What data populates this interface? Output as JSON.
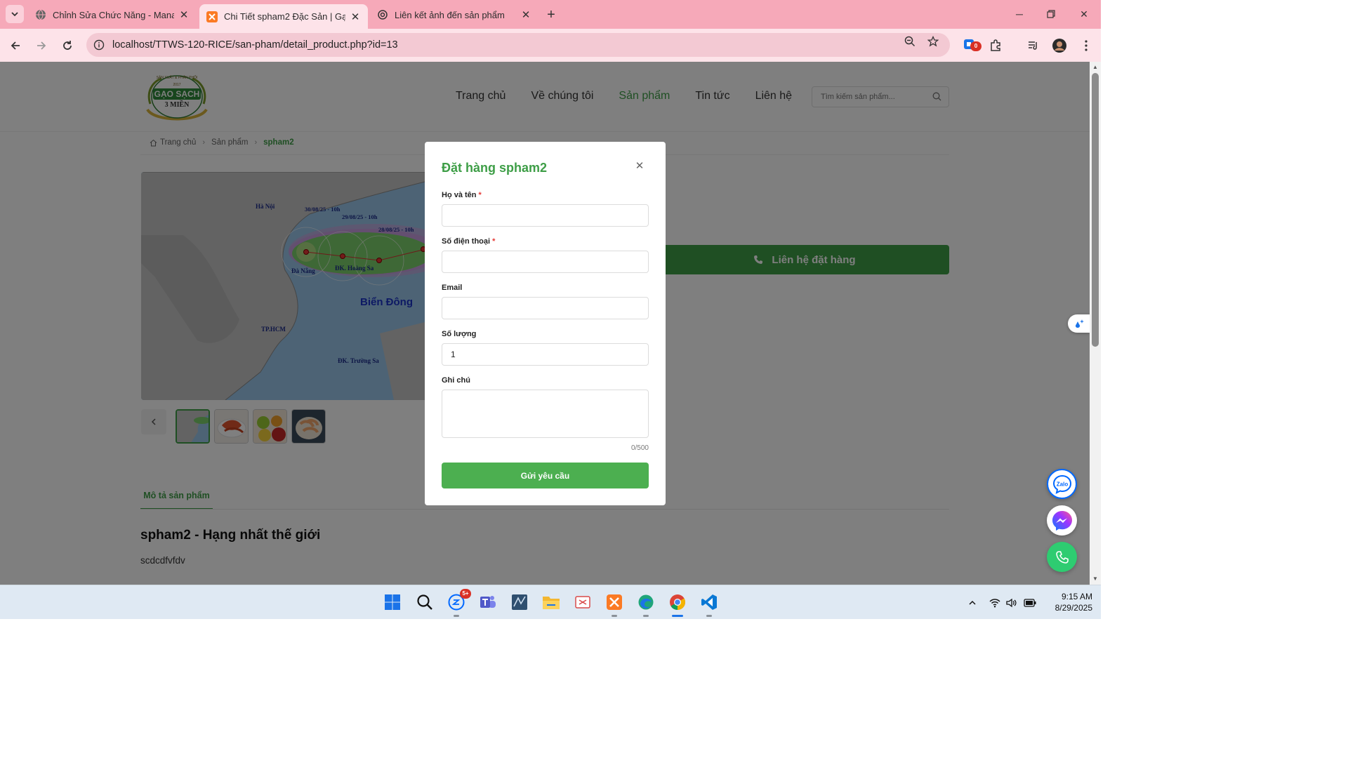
{
  "browser": {
    "tabs": [
      {
        "title": "Chỉnh Sửa Chức Năng - Manage",
        "active": false
      },
      {
        "title": "Chi Tiết spham2 Đặc Sản | Gạo Sạch",
        "active": true
      },
      {
        "title": "Liên kết ảnh đến sản phẩm",
        "active": false
      }
    ],
    "url": "localhost/TTWS-120-RICE/san-pham/detail_product.php?id=13",
    "extension_badge": "0"
  },
  "site": {
    "logo_text_top": "SẢN XUẤT & PHÂN PHỐI",
    "logo_year": "2017",
    "logo_main": "GẠO SẠCH",
    "logo_sub": "3 MIỀN",
    "nav": [
      "Trang chủ",
      "Về chúng tôi",
      "Sản phẩm",
      "Tin tức",
      "Liên hệ"
    ],
    "nav_active_index": 2,
    "search_placeholder": "Tìm kiếm sản phẩm..."
  },
  "breadcrumb": {
    "home": "Trang chủ",
    "category": "Sản phẩm",
    "current": "spham2"
  },
  "product_image": {
    "labels": {
      "hanoi": "Hà Nội",
      "track1": "30/08/25 - 10h",
      "track2": "29/08/25 - 10h",
      "track3": "28/08/25 - 10h",
      "danang": "Đà Nẵng",
      "hoangsa": "ĐK. Hoàng Sa",
      "biendong": "Biển Đông",
      "hcm": "TP.HCM",
      "truongsa": "ĐK. Trường Sa"
    }
  },
  "product": {
    "contact_button": "Liên hệ đặt hàng",
    "description_tab": "Mô tả sản phẩm",
    "description_title": "spham2 - Hạng nhất thế giới",
    "description_text": "scdcdfvfdv"
  },
  "modal": {
    "title": "Đặt hàng spham2",
    "fields": {
      "name_label": "Họ và tên",
      "phone_label": "Số điện thoại",
      "email_label": "Email",
      "quantity_label": "Số lượng",
      "quantity_value": "1",
      "note_label": "Ghi chú"
    },
    "required_mark": "*",
    "char_count": "0/500",
    "submit": "Gửi yêu cầu"
  },
  "float_buttons": {
    "zalo_label": "Zalo"
  },
  "taskbar": {
    "zalo_badge": "5+",
    "time": "9:15 AM",
    "date": "8/29/2025"
  },
  "colors": {
    "brand_green": "#3e9e47",
    "submit_green": "#4caf50",
    "chrome_pink": "#f6a9b9",
    "required_red": "#e53935"
  }
}
